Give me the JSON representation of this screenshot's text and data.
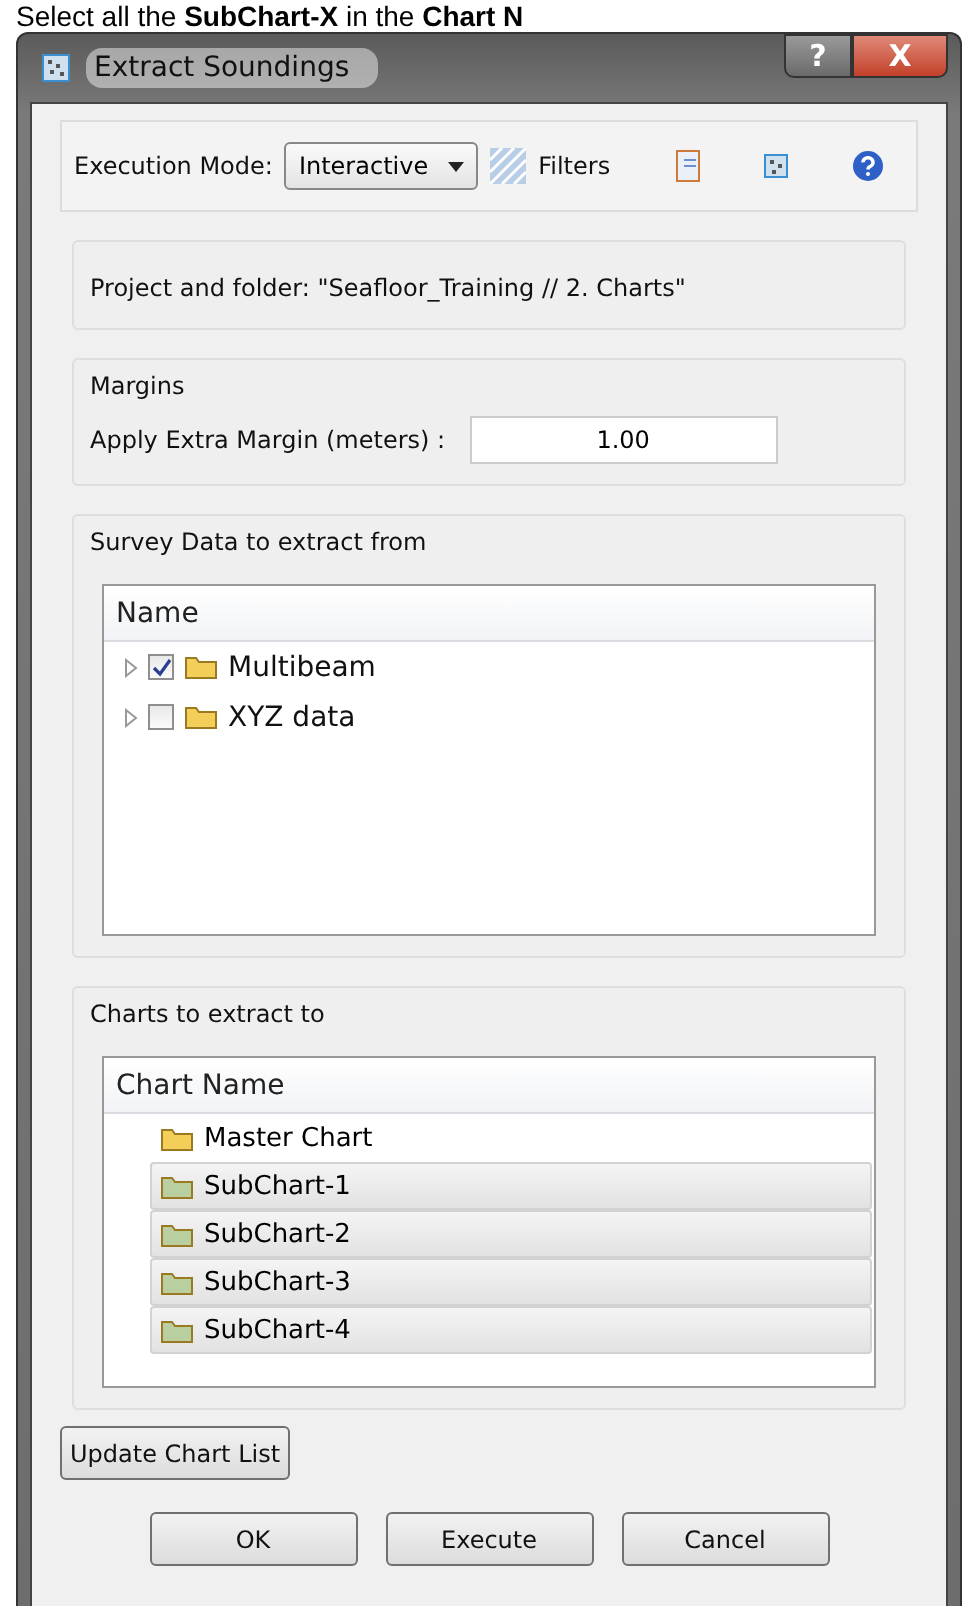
{
  "caption": "Select all the **SubChart-X** in the **Chart N**",
  "window": {
    "title": "Extract Soundings",
    "help_button": "?",
    "close_button": "X"
  },
  "toolbar": {
    "mode_label": "Execution Mode:",
    "mode_value": "Interactive",
    "filters_label": "Filters"
  },
  "project": {
    "text": "Project and folder: \"Seafloor_Training // 2. Charts\""
  },
  "margins": {
    "title": "Margins",
    "label": "Apply Extra Margin (meters) :",
    "value": "1.00"
  },
  "survey": {
    "title": "Survey Data to extract from",
    "column": "Name",
    "items": [
      {
        "label": "Multibeam",
        "checked": true
      },
      {
        "label": "XYZ data",
        "checked": false
      }
    ]
  },
  "charts": {
    "title": "Charts to extract to",
    "column": "Chart Name",
    "items": [
      {
        "label": "Master Chart",
        "kind": "master",
        "selected": false
      },
      {
        "label": "SubChart-1",
        "kind": "sub",
        "selected": true
      },
      {
        "label": "SubChart-2",
        "kind": "sub",
        "selected": true
      },
      {
        "label": "SubChart-3",
        "kind": "sub",
        "selected": true
      },
      {
        "label": "SubChart-4",
        "kind": "sub",
        "selected": true
      }
    ]
  },
  "update_button": "Update Chart List",
  "buttons": [
    "OK",
    "Execute",
    "Cancel"
  ]
}
